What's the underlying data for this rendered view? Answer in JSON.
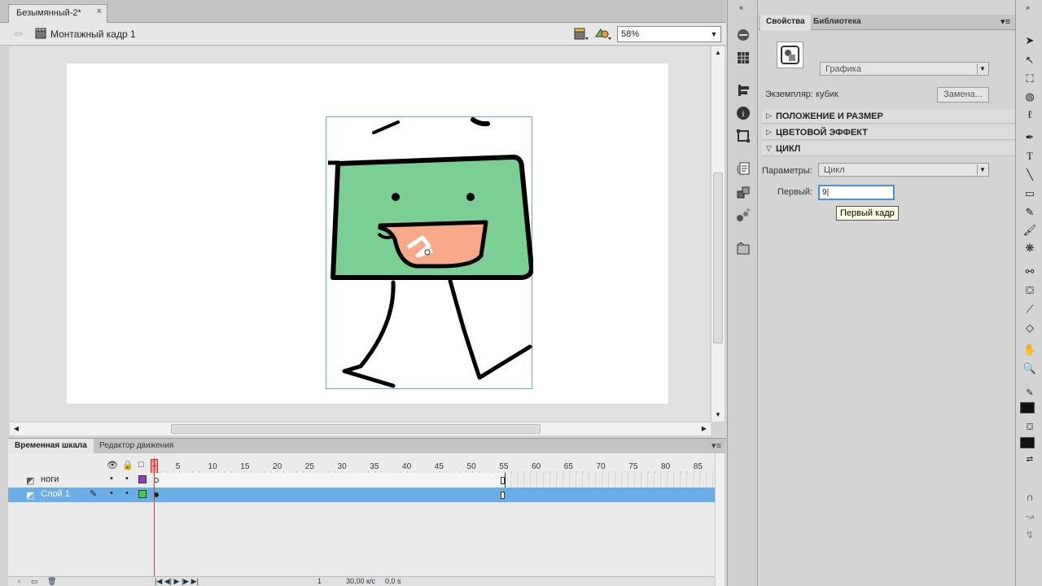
{
  "document": {
    "tab_title": "Безымянный-2*",
    "tab_close": "×",
    "scene_label": "Монтажный кадр 1",
    "zoom": "58%"
  },
  "timeline": {
    "tabs": [
      "Временная шкала",
      "Редактор движения"
    ],
    "playhead_frame": "1",
    "ruler_numbers": [
      "5",
      "10",
      "15",
      "20",
      "25",
      "30",
      "35",
      "40",
      "45",
      "50",
      "55",
      "60",
      "65",
      "70",
      "75",
      "80",
      "85"
    ],
    "layers": [
      {
        "name": "ноги",
        "color": "#8e3ec4",
        "selected": false
      },
      {
        "name": "Слой 1",
        "color": "#3ed04a",
        "selected": true
      }
    ],
    "footer": {
      "current_frame": "1",
      "fps": "30,00 к/с",
      "time": "0,0 s"
    }
  },
  "properties": {
    "tabs": [
      "Свойства",
      "Библиотека"
    ],
    "symbol_type": "Графика",
    "instance_label": "Экземпляр:",
    "instance_name": "кубик",
    "swap_button": "Замена...",
    "sections": [
      "ПОЛОЖЕНИЕ И РАЗМЕР",
      "ЦВЕТОВОЙ ЭФФЕКТ",
      "ЦИКЛ"
    ],
    "params_label": "Параметры:",
    "params_value": "Цикл",
    "first_label": "Первый:",
    "first_value": "9",
    "tooltip": "Первый кадр"
  },
  "colors": {
    "face_fill": "#7ccf94",
    "mouth_fill": "#f7a98a",
    "selection_outline": "#6aa7c8",
    "selected_layer": "#6aaee6",
    "playhead": "#dd3333"
  },
  "icons": {
    "tools": [
      "selection-icon",
      "subselection-icon",
      "free-transform-icon",
      "3d-rotation-icon",
      "lasso-icon",
      "pen-icon",
      "text-icon",
      "line-icon",
      "rectangle-icon",
      "pencil-icon",
      "brush-icon",
      "deco-icon",
      "bone-icon",
      "paint-bucket-icon",
      "eyedropper-icon",
      "eraser-icon",
      "hand-icon",
      "zoom-icon"
    ]
  }
}
